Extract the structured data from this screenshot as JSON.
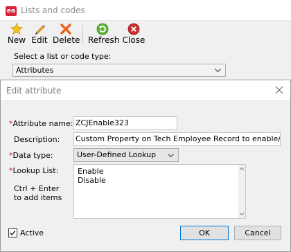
{
  "background_window": {
    "title": "Lists and codes",
    "logo_text": "ea",
    "toolbar": {
      "new": "New",
      "edit": "Edit",
      "delete": "Delete",
      "refresh": "Refresh",
      "close": "Close"
    },
    "select_label": "Select a list or code type:",
    "select_value": "Attributes"
  },
  "dialog": {
    "title": "Edit attribute",
    "required_mark": "*",
    "fields": {
      "attribute_name": {
        "label": "Attribute name:",
        "value": "ZCJEnable323"
      },
      "description": {
        "label": "Description:",
        "value": "Custom Property on Tech Employee Record to enable/disable"
      },
      "data_type": {
        "label": "Data type:",
        "value": "User-Defined Lookup"
      },
      "lookup_list": {
        "label": "Lookup List:",
        "items": [
          "Enable",
          "Disable"
        ]
      }
    },
    "hint_line1": "Ctrl + Enter",
    "hint_line2": "to add items",
    "active_label": "Active",
    "active_checked": true,
    "ok_label": "OK",
    "cancel_label": "Cancel"
  },
  "colors": {
    "required": "#d52020",
    "logo": "#d8233a",
    "ok_border": "#0078d7"
  }
}
